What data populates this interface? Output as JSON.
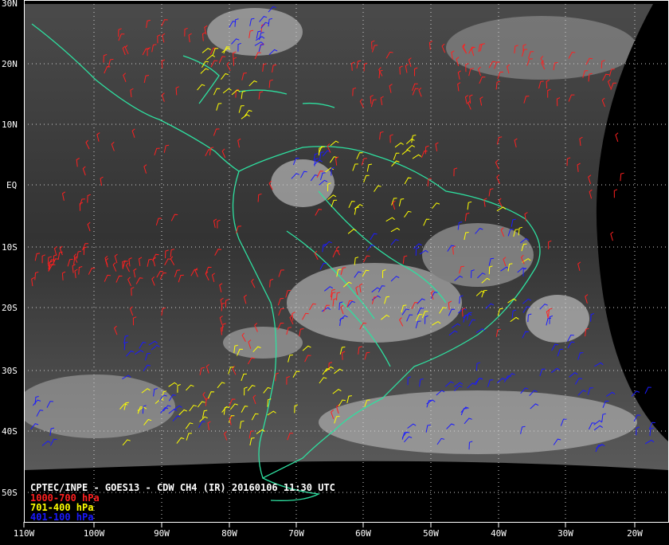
{
  "caption": {
    "title": "CPTEC/INPE - GOES13 - CDW CH4 (IR) 20160106 11:30 UTC",
    "legend": [
      {
        "label": "1000-700 hPa",
        "color": "#ff2020"
      },
      {
        "label": "701-400 hPa",
        "color": "#ffff00"
      },
      {
        "label": "401-100 hPa",
        "color": "#1a1aff"
      }
    ]
  },
  "lat_labels": [
    "30N",
    "20N",
    "10N",
    "EQ",
    "10S",
    "20S",
    "30S",
    "40S",
    "50S"
  ],
  "lon_labels": [
    "110W",
    "100W",
    "90W",
    "80W",
    "70W",
    "60W",
    "50W",
    "40W",
    "30W",
    "20W"
  ],
  "colors": {
    "background": "#000000",
    "cloud_field": "#3a3a3a",
    "coastline": "#2ee0a0",
    "grid": "#d0d0d0"
  }
}
